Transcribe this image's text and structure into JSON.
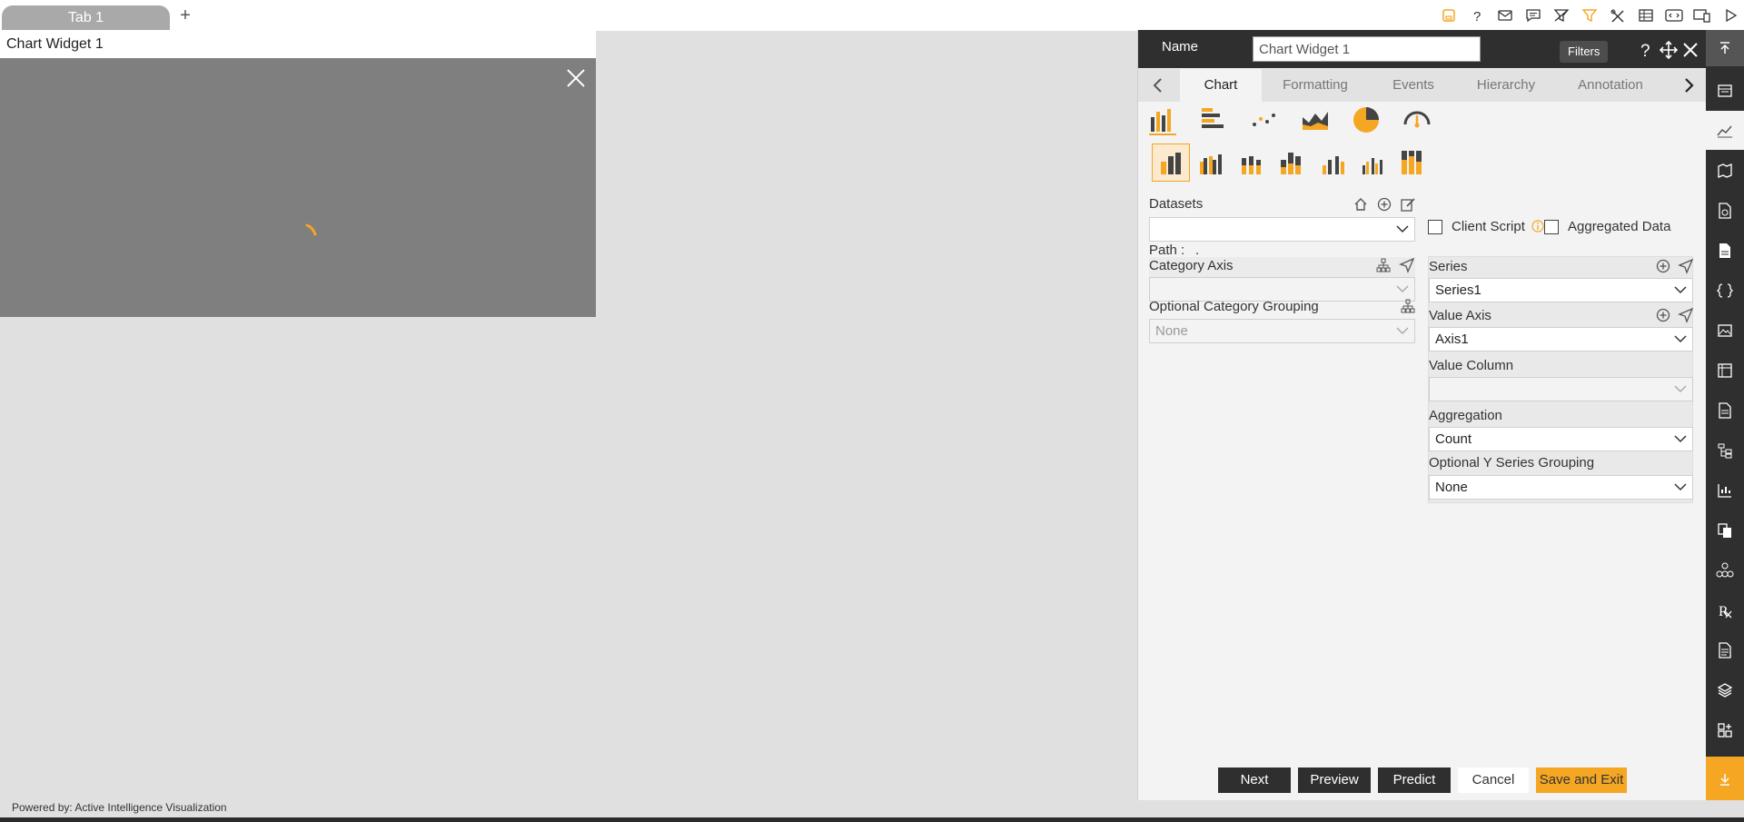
{
  "tabs": {
    "tab1": "Tab 1",
    "add_label": "+"
  },
  "widget": {
    "title": "Chart Widget 1"
  },
  "panel": {
    "name_label": "Name",
    "name_value": "Chart Widget 1",
    "filters_tooltip": "Filters",
    "tabs": [
      "Chart",
      "Formatting",
      "Events",
      "Hierarchy",
      "Annotation"
    ],
    "datasets_label": "Datasets",
    "datasets_value": "",
    "path_label": "Path :",
    "path_value": ".",
    "client_script_label": "Client Script",
    "aggregated_data_label": "Aggregated Data",
    "category_axis_label": "Category Axis",
    "category_axis_value": "",
    "optional_category_grouping_label": "Optional Category Grouping",
    "optional_category_grouping_value": "None",
    "series_label": "Series",
    "series_value": "Series1",
    "value_axis_label": "Value Axis",
    "value_axis_value": "Axis1",
    "value_column_label": "Value Column",
    "value_column_value": "",
    "aggregation_label": "Aggregation",
    "aggregation_value": "Count",
    "optional_y_series_grouping_label": "Optional Y Series Grouping",
    "optional_y_series_grouping_value": "None",
    "buttons": {
      "next": "Next",
      "preview": "Preview",
      "predict": "Predict",
      "cancel": "Cancel",
      "save_exit": "Save and Exit"
    }
  },
  "footer": {
    "text": "Powered by: Active Intelligence Visualization"
  },
  "colors": {
    "accent": "#f5a623",
    "dark": "#2f2f2f",
    "panel_bg": "#f3f3f3",
    "canvas_bg": "#e0e0e0"
  }
}
